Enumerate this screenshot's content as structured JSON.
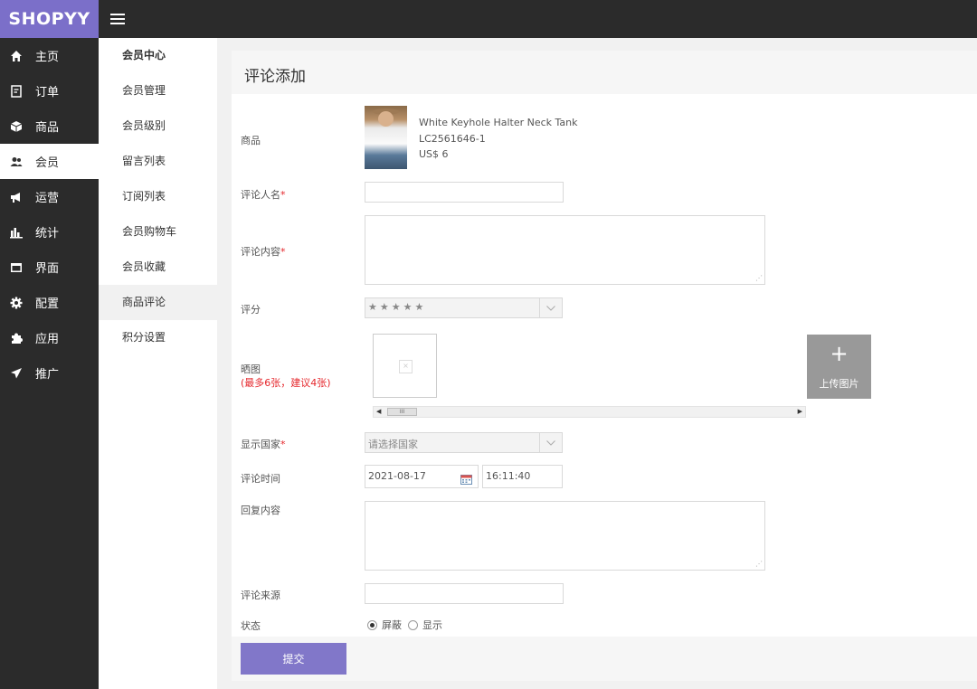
{
  "brand": "SHOPYY",
  "sidebar": {
    "items": [
      {
        "label": "主页",
        "icon": "home-icon"
      },
      {
        "label": "订单",
        "icon": "order-icon"
      },
      {
        "label": "商品",
        "icon": "box-icon"
      },
      {
        "label": "会员",
        "icon": "members-icon"
      },
      {
        "label": "运营",
        "icon": "megaphone-icon"
      },
      {
        "label": "统计",
        "icon": "bar-chart-icon"
      },
      {
        "label": "界面",
        "icon": "window-icon"
      },
      {
        "label": "配置",
        "icon": "gear-icon"
      },
      {
        "label": "应用",
        "icon": "puzzle-icon"
      },
      {
        "label": "推广",
        "icon": "send-icon"
      }
    ]
  },
  "subnav": {
    "items": [
      {
        "label": "会员中心"
      },
      {
        "label": "会员管理"
      },
      {
        "label": "会员级别"
      },
      {
        "label": "留言列表"
      },
      {
        "label": "订阅列表"
      },
      {
        "label": "会员购物车"
      },
      {
        "label": "会员收藏"
      },
      {
        "label": "商品评论"
      },
      {
        "label": "积分设置"
      }
    ]
  },
  "page": {
    "title": "评论添加"
  },
  "form": {
    "product_label": "商品",
    "product": {
      "name": "White Keyhole Halter Neck Tank",
      "sku": "LC2561646-1",
      "price": "US$ 6"
    },
    "reviewer_label": "评论人名",
    "reviewer_value": "",
    "content_label": "评论内容",
    "content_value": "",
    "rating_label": "评分",
    "rating_stars": "★★★★★",
    "photos_label": "晒图",
    "photos_hint": "(最多6张，建议4张)",
    "upload_label": "上传图片",
    "country_label": "显示国家",
    "country_placeholder": "请选择国家",
    "time_label": "评论时间",
    "date_value": "2021-08-17",
    "time_value": "16:11:40",
    "reply_label": "回复内容",
    "reply_value": "",
    "source_label": "评论来源",
    "source_value": "",
    "status_label": "状态",
    "status_options": [
      "屏蔽",
      "显示"
    ],
    "status_selected": "屏蔽",
    "required_mark": "*",
    "submit_label": "提交"
  },
  "colors": {
    "brand": "#7b6fc9",
    "dark": "#2b2b2b",
    "submit": "#8177c9",
    "required": "#e5262b"
  }
}
